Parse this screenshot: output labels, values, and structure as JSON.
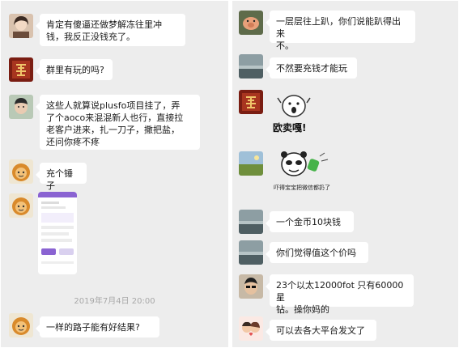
{
  "left_chat": {
    "messages": [
      {
        "text": "肯定有傻逼还做梦解冻往里冲\n钱，我反正没钱充了。"
      },
      {
        "text": "群里有玩的吗?"
      },
      {
        "text": "这些人就算说plusfo项目挂了，弄\n了个aoco来混混新人也行，直接拉\n老客户进来，扎一刀子，撒把盐，\n还问你疼不疼"
      },
      {
        "text": "充个锤子"
      },
      {
        "text": "一样的路子能有好结果?"
      }
    ],
    "timestamp": "2019年7月4日 20:00"
  },
  "right_chat": {
    "messages": [
      {
        "text": "一层层往上趴，你们说能趴得出来\n不。"
      },
      {
        "text": "不然要充钱才能玩"
      },
      {
        "text": "一个金币10块钱"
      },
      {
        "text": "你们觉得值这个价吗"
      },
      {
        "text": "23个以太12000fot  只有60000星\n钻。操你妈的"
      },
      {
        "text": "可以去各大平台发文了"
      }
    ],
    "sticker_text": {
      "oumaiga": "欧卖嘎!",
      "caption": "吓得宝宝把微信都扔了"
    }
  },
  "colors": {
    "chat_background": "#ededed",
    "bubble": "#ffffff",
    "timestamp": "#a8a8a8",
    "accent_purple": "#8a63d2"
  }
}
